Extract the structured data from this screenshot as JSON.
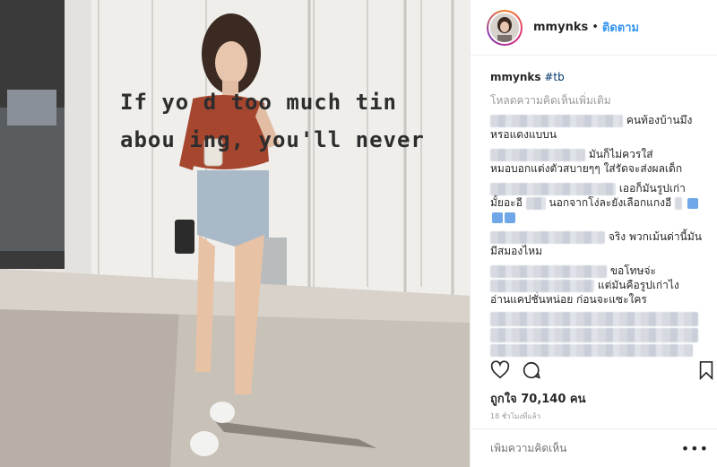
{
  "photo": {
    "wall_line1": "If yo    d too much tin",
    "wall_line2": "abou    ing, you'll never"
  },
  "header": {
    "username": "mmynks",
    "dot": "•",
    "follow_label": "ติดตาม"
  },
  "caption": {
    "username": "mmynks",
    "text": "#tb"
  },
  "load_more_label": "โหลดความคิดเห็นเพิ่มเติม",
  "comments": [
    {
      "text": "คนท้องบ้านมึง"
    },
    {
      "text": "หรอแดงแบบน"
    },
    {
      "text": "มันก็ไม่ควรใส่"
    },
    {
      "text": "หมอบอกแต่งตัวสบายๆๆ ใส่รัดจะส่งผลเด็ก"
    },
    {
      "text": "เออก็มันรูปเก่า"
    },
    {
      "text": "มั้ยอะอี"
    },
    {
      "text": "นอกจากโง่ละยังเลือกแกงอี"
    },
    {
      "text": "จริง พวกเม้นด่านี้มัน"
    },
    {
      "text": "มีสมองไหม"
    },
    {
      "text": "ขอโทษจ่ะ"
    },
    {
      "text": "แต่มันคือรูปเก่าไง"
    },
    {
      "text": "อ่านแคปชั่นหน่อย ก่อนจะแซะใคร"
    }
  ],
  "likes_label": "ถูกใจ 70,140 คน",
  "time_label": "18 ชั่วโมงที่แล้ว",
  "add_comment_placeholder": "เพิ่มความคิดเห็น",
  "more_label": "•••",
  "colors": {
    "link_blue": "#3897f0",
    "hashtag": "#003569",
    "muted": "#999999"
  }
}
